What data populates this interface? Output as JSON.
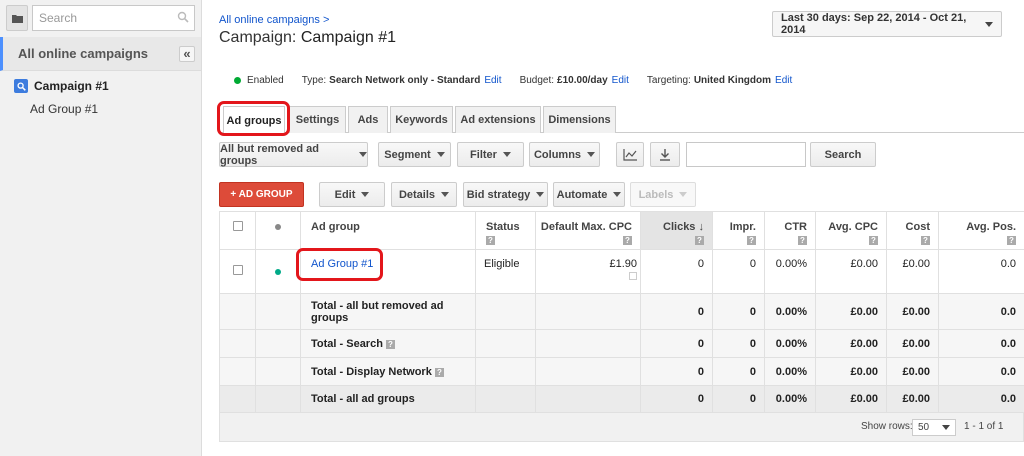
{
  "sidebar": {
    "search_placeholder": "Search",
    "all_campaigns": "All online campaigns",
    "campaign": "Campaign #1",
    "ad_group": "Ad Group #1"
  },
  "header": {
    "breadcrumb": "All online campaigns >",
    "title_prefix": "Campaign:",
    "title_name": "Campaign #1",
    "date_range": "Last 30 days: Sep 22, 2014 - Oct 21, 2014"
  },
  "info": {
    "status": "Enabled",
    "type_label": "Type:",
    "type_value": "Search Network only - Standard",
    "budget_label": "Budget:",
    "budget_value": "£10.00/day",
    "targeting_label": "Targeting:",
    "targeting_value": "United Kingdom",
    "edit": "Edit"
  },
  "tabs": [
    "Ad groups",
    "Settings",
    "Ads",
    "Keywords",
    "Ad extensions",
    "Dimensions"
  ],
  "toolbar1": {
    "filter_view": "All but removed ad groups",
    "segment": "Segment",
    "filter": "Filter",
    "columns": "Columns",
    "search": "Search"
  },
  "toolbar2": {
    "add": "+ AD GROUP",
    "edit": "Edit",
    "details": "Details",
    "bid_strategy": "Bid strategy",
    "automate": "Automate",
    "labels": "Labels"
  },
  "table": {
    "headers": {
      "ad_group": "Ad group",
      "status": "Status",
      "cpc": "Default Max. CPC",
      "clicks": "Clicks",
      "impr": "Impr.",
      "ctr": "CTR",
      "avg_cpc": "Avg. CPC",
      "cost": "Cost",
      "avg_pos": "Avg. Pos."
    },
    "row": {
      "name": "Ad Group #1",
      "status": "Eligible",
      "cpc": "£1.90",
      "clicks": "0",
      "impr": "0",
      "ctr": "0.00%",
      "avg_cpc": "£0.00",
      "cost": "£0.00",
      "avg_pos": "0.0"
    },
    "totals": [
      {
        "label": "Total - all but removed ad groups",
        "clicks": "0",
        "impr": "0",
        "ctr": "0.00%",
        "avg_cpc": "£0.00",
        "cost": "£0.00",
        "avg_pos": "0.0"
      },
      {
        "label": "Total - Search",
        "clicks": "0",
        "impr": "0",
        "ctr": "0.00%",
        "avg_cpc": "£0.00",
        "cost": "£0.00",
        "avg_pos": "0.0"
      },
      {
        "label": "Total - Display Network",
        "clicks": "0",
        "impr": "0",
        "ctr": "0.00%",
        "avg_cpc": "£0.00",
        "cost": "£0.00",
        "avg_pos": "0.0"
      },
      {
        "label": "Total - all ad groups",
        "clicks": "0",
        "impr": "0",
        "ctr": "0.00%",
        "avg_cpc": "£0.00",
        "cost": "£0.00",
        "avg_pos": "0.0"
      }
    ],
    "qmark": "?"
  },
  "pager": {
    "show_rows": "Show rows:",
    "rows_value": "50",
    "range": "1 - 1 of 1"
  },
  "colors": {
    "accent_blue": "#4d90fe",
    "link": "#1155cc",
    "add_button": "#dd4b39",
    "highlight_ring": "#e3161b",
    "enabled_dot": "#00aa33"
  }
}
